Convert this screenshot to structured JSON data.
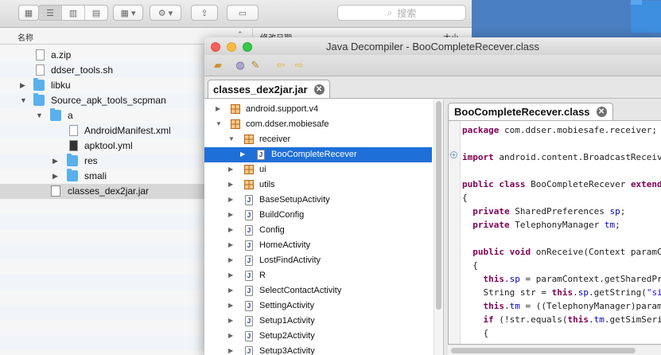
{
  "finder": {
    "search_placeholder": "搜索",
    "columns": {
      "name": "名称",
      "modified": "修改日期",
      "size": "大小"
    },
    "files": [
      {
        "name": "a.zip"
      },
      {
        "name": "ddser_tools.sh"
      },
      {
        "name": "libku"
      },
      {
        "name": "Source_apk_tools_scpman"
      },
      {
        "name": "a"
      },
      {
        "name": "AndroidManifest.xml"
      },
      {
        "name": "apktool.yml"
      },
      {
        "name": "res"
      },
      {
        "name": "smali"
      },
      {
        "name": "classes_dex2jar.jar"
      }
    ]
  },
  "decompiler": {
    "title": "Java Decompiler - BooCompleteRecever.class",
    "file_tab": "classes_dex2jar.jar",
    "close_glyph": "✕",
    "tree": [
      {
        "label": "android.support.v4"
      },
      {
        "label": "com.ddser.mobiesafe"
      },
      {
        "label": "receiver"
      },
      {
        "label": "BooCompleteRecever"
      },
      {
        "label": "ui"
      },
      {
        "label": "utils"
      },
      {
        "label": "BaseSetupActivity"
      },
      {
        "label": "BuildConfig"
      },
      {
        "label": "Config"
      },
      {
        "label": "HomeActivity"
      },
      {
        "label": "LostFindActivity"
      },
      {
        "label": "R"
      },
      {
        "label": "SelectContactActivity"
      },
      {
        "label": "SettingActivity"
      },
      {
        "label": "Setup1Activity"
      },
      {
        "label": "Setup2Activity"
      },
      {
        "label": "Setup3Activity"
      }
    ],
    "code_tab": "BooCompleteRecever.class",
    "code": {
      "l1a": "package",
      "l1b": " com.ddser.mobiesafe.receiver;",
      "l2a": "import",
      "l2b": " android.content.BroadcastReceive",
      "l3a": "public class",
      "l3b": " BooCompleteRecever ",
      "l3c": "extends",
      "l4": "{",
      "l5a": "  private",
      "l5b": " SharedPreferences ",
      "l5c": "sp",
      "l5d": ";",
      "l6a": "  private",
      "l6b": " TelephonyManager ",
      "l6c": "tm",
      "l6d": ";",
      "l7a": "  public void",
      "l7b": " onReceive(Context paramCo",
      "l8": "  {",
      "l9a": "    this",
      "l9b": ".",
      "l9c": "sp",
      "l9d": " = paramContext.getSharedPre",
      "l10a": "    String str = ",
      "l10b": "this",
      "l10c": ".",
      "l10d": "sp",
      "l10e": ".getString(",
      "l10f": "\"sim",
      "l11a": "    this",
      "l11b": ".",
      "l11c": "tm",
      "l11d": " = ((TelephonyManager)paramC",
      "l12a": "    if",
      "l12b": " (!str.equals(",
      "l12c": "this",
      "l12d": ".",
      "l12e": "tm",
      "l12f": ".getSimSeria",
      "l13": "    {"
    }
  }
}
